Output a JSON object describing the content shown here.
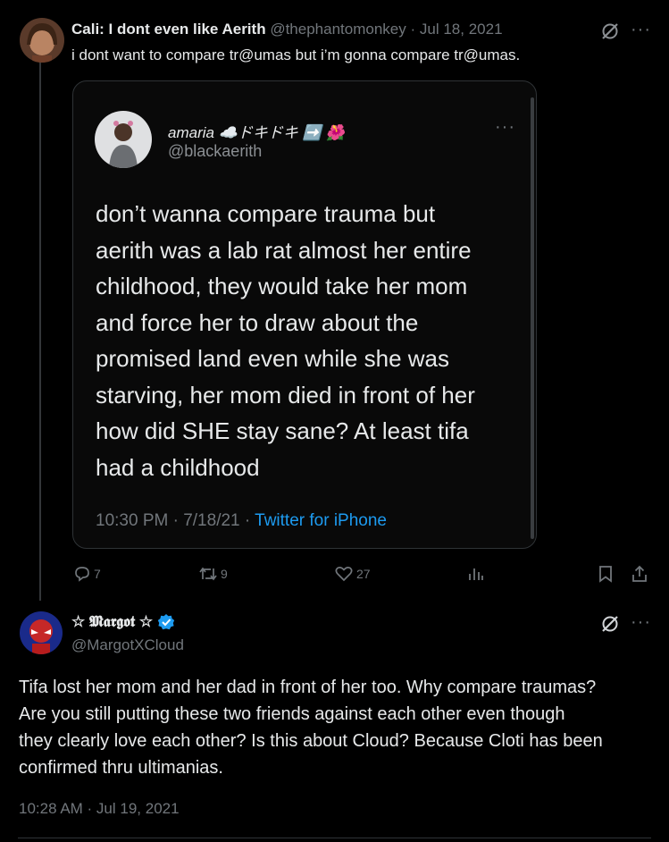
{
  "tweet1": {
    "display_name": "Cali: I dont even like Aerith",
    "handle": "@thephantomonkey",
    "separator": "·",
    "date": "Jul 18, 2021",
    "text": "i dont want to compare tr@umas but i’m gonna compare tr@umas.",
    "more_label": "···"
  },
  "embedded": {
    "name": "amaria ☁️ドキドキ ➡️ 🌺",
    "handle": "@blackaerith",
    "more_label": "···",
    "lines": [
      "don’t wanna compare trauma but",
      "aerith was a lab rat almost her entire",
      "childhood, they would take her mom",
      "and force her to draw about the",
      "promised land even while she was",
      "starving, her mom died in front of her",
      "how did SHE stay sane? At least tifa",
      "had a childhood"
    ],
    "time": "10:30 PM · 7/18/21 · ",
    "source": "Twitter for iPhone"
  },
  "actions": {
    "replies": "7",
    "retweets": "9",
    "likes": "27"
  },
  "tweet3": {
    "display_name": "☆ 𝕸𝖆𝖗𝖌𝖔𝖙 ☆",
    "handle": "@MargotXCloud",
    "more_label": "···",
    "lines": [
      "Tifa lost her mom and her dad in front of her too. Why compare traumas?",
      "Are you still putting these two friends against each other even though",
      "they clearly love each other? Is this about Cloud? Because Cloti has been",
      "confirmed thru ultimanias."
    ],
    "timestamp": "10:28 AM · Jul 19, 2021"
  },
  "colors": {
    "background": "#000000",
    "text": "#e7e9ea",
    "muted": "#71767b",
    "link": "#1d9bf0",
    "border": "#2f3336"
  }
}
